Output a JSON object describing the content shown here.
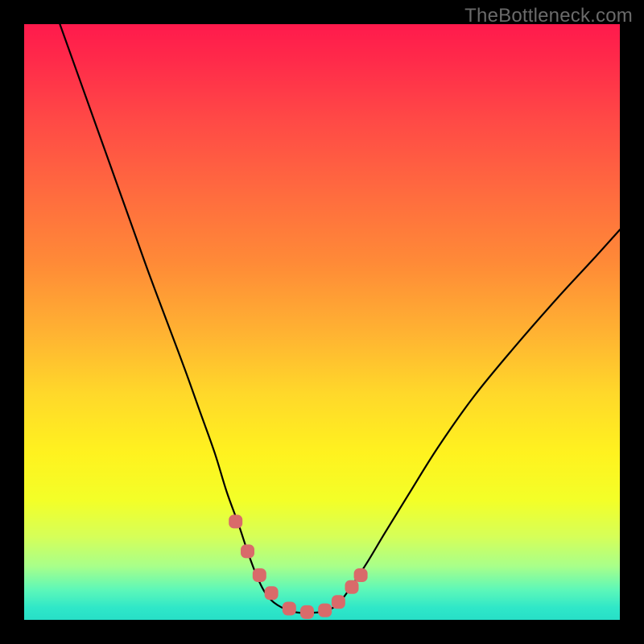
{
  "watermark": "TheBottleneck.com",
  "chart_data": {
    "type": "line",
    "title": "",
    "xlabel": "",
    "ylabel": "",
    "xlim": [
      0,
      1
    ],
    "ylim": [
      0,
      1
    ],
    "series": [
      {
        "name": "curve",
        "x": [
          0.06,
          0.11,
          0.135,
          0.16,
          0.185,
          0.21,
          0.24,
          0.27,
          0.295,
          0.32,
          0.34,
          0.36,
          0.375,
          0.39,
          0.405,
          0.425,
          0.455,
          0.485,
          0.505,
          0.525,
          0.545,
          0.575,
          0.605,
          0.645,
          0.695,
          0.755,
          0.825,
          0.895,
          0.955,
          1.0
        ],
        "values": [
          1.0,
          0.86,
          0.79,
          0.72,
          0.65,
          0.58,
          0.5,
          0.42,
          0.35,
          0.28,
          0.215,
          0.16,
          0.115,
          0.075,
          0.045,
          0.025,
          0.013,
          0.012,
          0.015,
          0.025,
          0.05,
          0.095,
          0.145,
          0.21,
          0.29,
          0.375,
          0.46,
          0.54,
          0.605,
          0.655
        ]
      }
    ],
    "markers": {
      "name": "highlight-dots",
      "color": "#d96a6a",
      "x": [
        0.355,
        0.375,
        0.395,
        0.415,
        0.445,
        0.475,
        0.505,
        0.5275,
        0.565,
        0.55
      ],
      "values": [
        0.165,
        0.115,
        0.075,
        0.045,
        0.019,
        0.013,
        0.016,
        0.03,
        0.075,
        0.055
      ]
    },
    "gradient_stops": [
      {
        "pos": 0.0,
        "color": "#ff1a4c"
      },
      {
        "pos": 0.4,
        "color": "#ff8a37"
      },
      {
        "pos": 0.72,
        "color": "#fff21f"
      },
      {
        "pos": 0.95,
        "color": "#5cf7b9"
      },
      {
        "pos": 1.0,
        "color": "#27dfc7"
      }
    ]
  }
}
